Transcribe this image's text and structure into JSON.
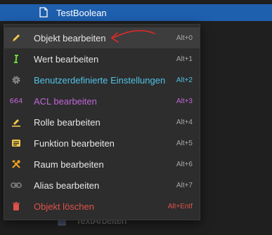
{
  "tree": {
    "selected_item": "TestBoolean",
    "faded_item": "TextArbeiten"
  },
  "menu": {
    "items": [
      {
        "label": "Objekt bearbeiten",
        "shortcut": "Alt+0",
        "icon": "pencil-icon"
      },
      {
        "label": "Wert bearbeiten",
        "shortcut": "Alt+1",
        "icon": "value-cursor-icon"
      },
      {
        "label": "Benutzerdefinierte Einstellungen",
        "shortcut": "Alt+2",
        "icon": "gear-icon"
      },
      {
        "label": "ACL bearbeiten",
        "shortcut": "Alt+3",
        "icon": "acl-664-icon",
        "icon_text": "664"
      },
      {
        "label": "Rolle bearbeiten",
        "shortcut": "Alt+4",
        "icon": "role-pencil-icon"
      },
      {
        "label": "Funktion bearbeiten",
        "shortcut": "Alt+5",
        "icon": "function-list-icon"
      },
      {
        "label": "Raum bearbeiten",
        "shortcut": "Alt+6",
        "icon": "tools-icon"
      },
      {
        "label": "Alias bearbeiten",
        "shortcut": "Alt+7",
        "icon": "link-icon"
      },
      {
        "label": "Objekt löschen",
        "shortcut": "Alt+Entf",
        "icon": "trash-icon"
      }
    ]
  },
  "colors": {
    "selection": "#1e5fae",
    "menu_bg": "#2d2d2d",
    "cyan": "#4fc3e6",
    "purple": "#c066d8",
    "red": "#e0524a",
    "yellow": "#f2c94c",
    "green": "#6fdc3a",
    "orange": "#f0a020",
    "annotation": "#d22b2b"
  }
}
